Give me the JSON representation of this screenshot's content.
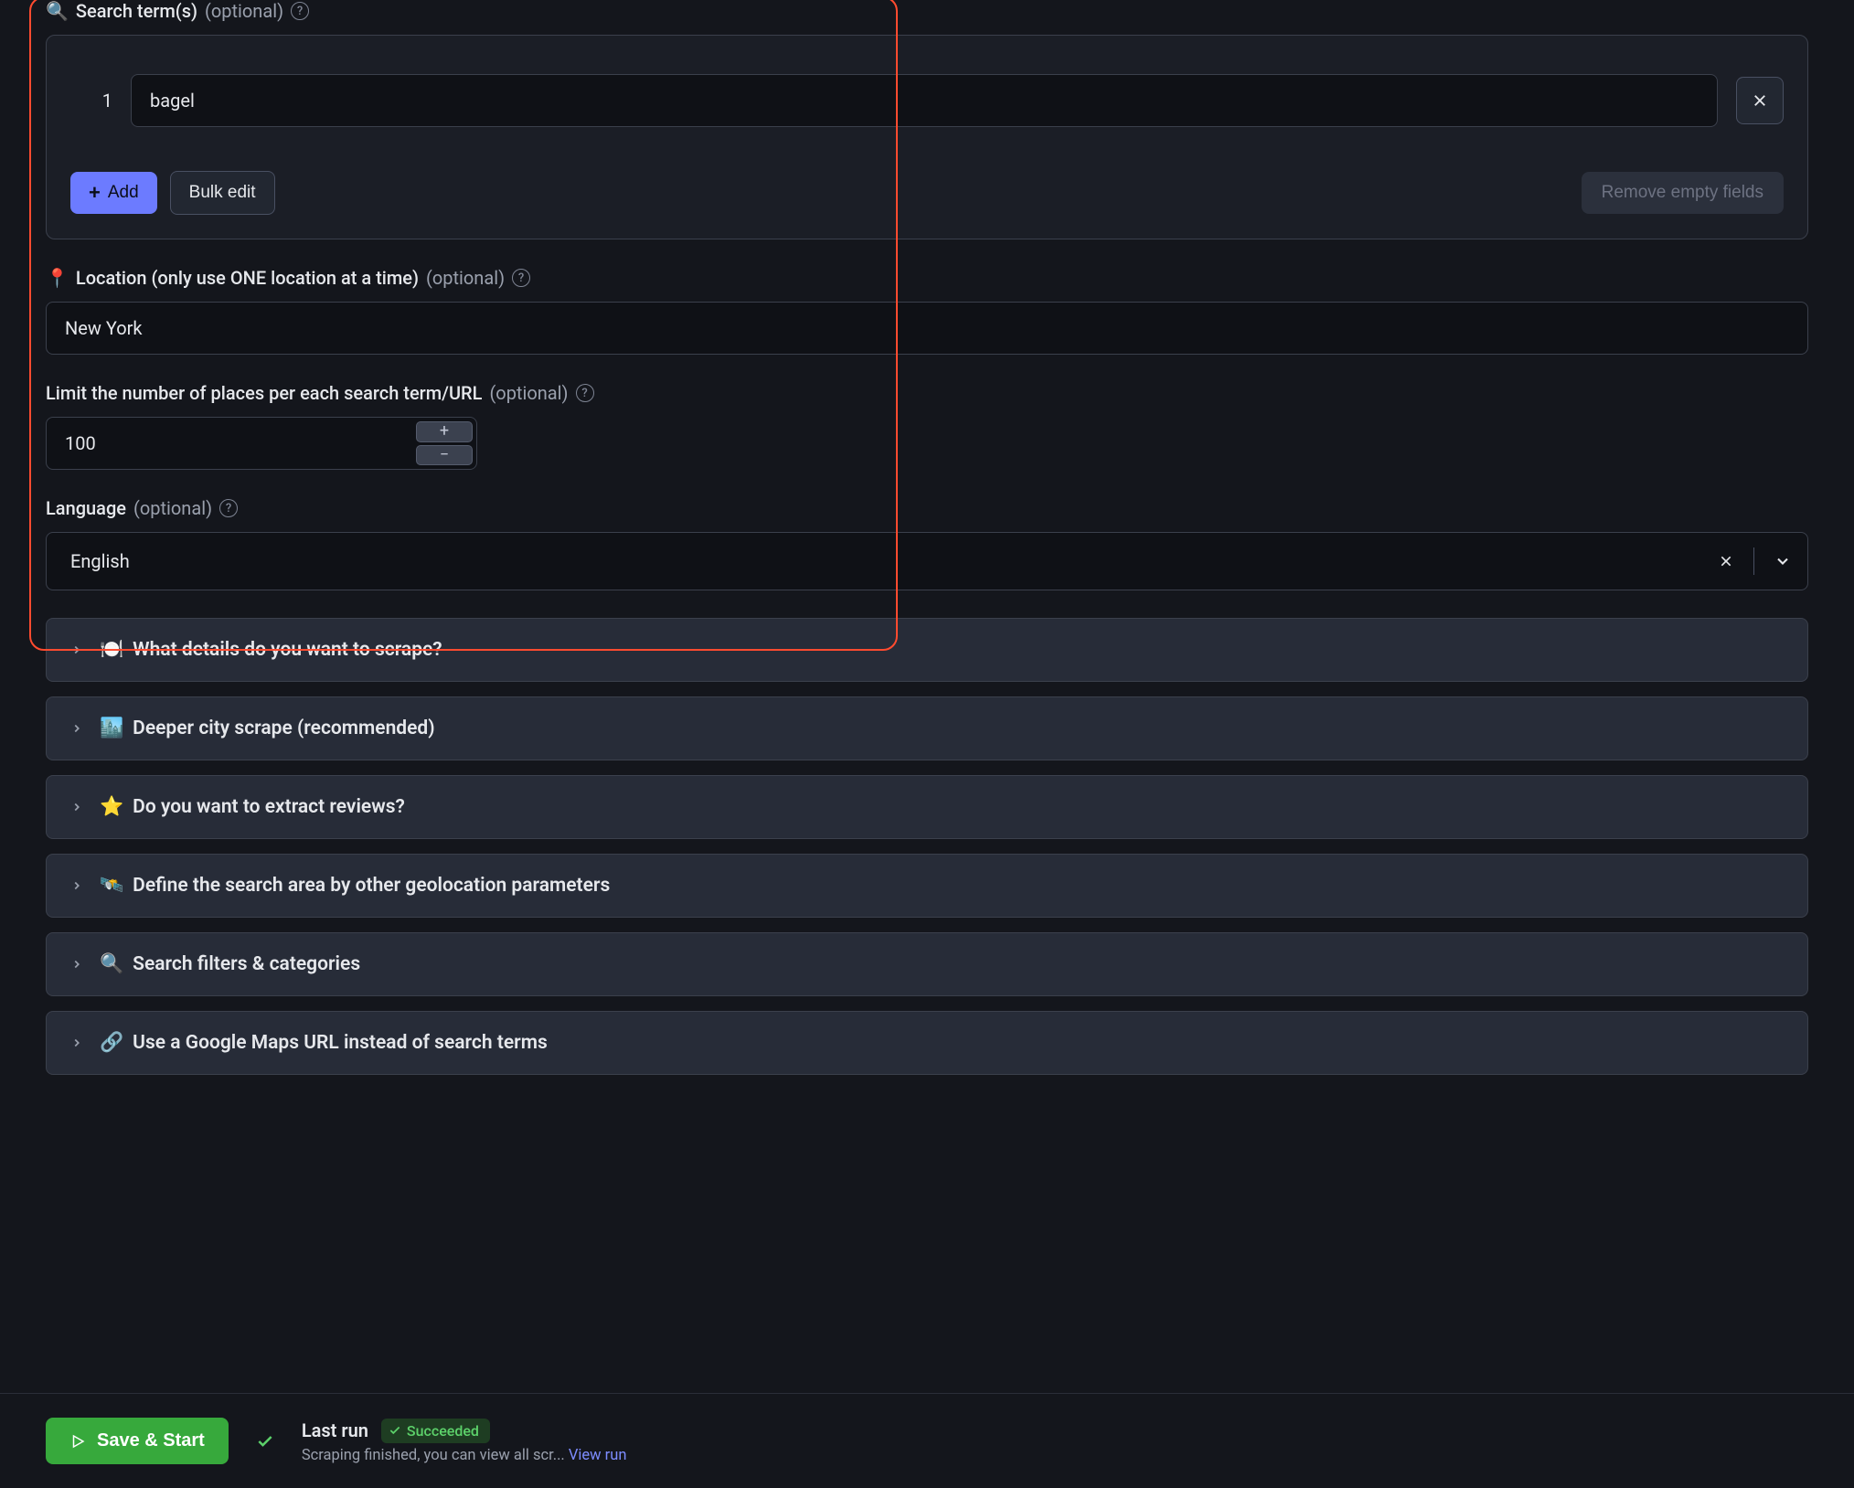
{
  "search_terms": {
    "emoji": "🔍",
    "label": "Search term(s)",
    "optional": "(optional)",
    "items": [
      {
        "index": "1",
        "value": "bagel"
      }
    ],
    "add_label": "Add",
    "bulk_label": "Bulk edit",
    "remove_empty_label": "Remove empty fields"
  },
  "location": {
    "emoji": "📍",
    "label": "Location (only use ONE location at a time)",
    "optional": "(optional)",
    "value": "New York"
  },
  "limit": {
    "label": "Limit the number of places per each search term/URL",
    "optional": "(optional)",
    "value": "100"
  },
  "language": {
    "label": "Language",
    "optional": "(optional)",
    "value": "English"
  },
  "accordions": [
    {
      "emoji": "🍽️",
      "title": "What details do you want to scrape?"
    },
    {
      "emoji": "🏙️",
      "title": "Deeper city scrape (recommended)"
    },
    {
      "emoji": "⭐",
      "title": "Do you want to extract reviews?"
    },
    {
      "emoji": "🛰️",
      "title": "Define the search area by other geolocation parameters"
    },
    {
      "emoji": "🔍",
      "title": "Search filters & categories"
    },
    {
      "emoji": "🔗",
      "title": "Use a Google Maps URL instead of search terms"
    }
  ],
  "footer": {
    "save_label": "Save & Start",
    "lastrun_title": "Last run",
    "badge_text": "Succeeded",
    "sub_text": "Scraping finished, you can view all scr...",
    "link_text": "View run"
  }
}
